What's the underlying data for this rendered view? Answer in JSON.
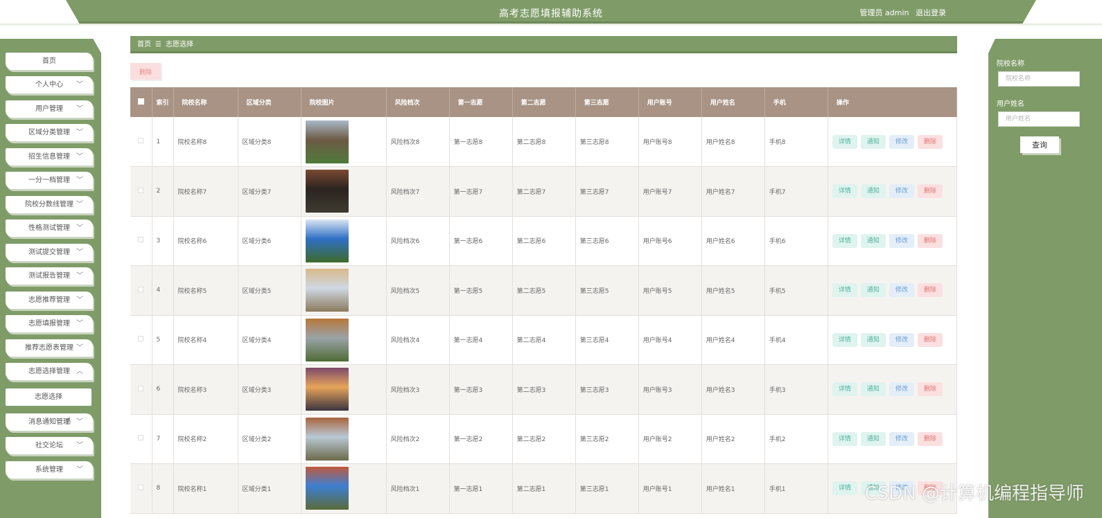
{
  "header": {
    "title": "高考志愿填报辅助系统",
    "user_label": "管理员 admin",
    "logout": "退出登录"
  },
  "sidebar": {
    "items": [
      {
        "label": "首页",
        "chevron": false
      },
      {
        "label": "个人中心",
        "chevron": true
      },
      {
        "label": "用户管理",
        "chevron": true
      },
      {
        "label": "区域分类管理",
        "chevron": true
      },
      {
        "label": "招生信息管理",
        "chevron": true
      },
      {
        "label": "一分一档管理",
        "chevron": true
      },
      {
        "label": "院校分数线管理",
        "chevron": true
      },
      {
        "label": "性格测试管理",
        "chevron": true
      },
      {
        "label": "测试提交管理",
        "chevron": true
      },
      {
        "label": "测试报告管理",
        "chevron": true
      },
      {
        "label": "志愿推荐管理",
        "chevron": true
      },
      {
        "label": "志愿填报管理",
        "chevron": true
      },
      {
        "label": "推荐志愿表管理",
        "chevron": true
      },
      {
        "label": "志愿选择管理",
        "chevron": true,
        "expanded": true
      },
      {
        "label": "志愿选择",
        "chevron": false,
        "sub": true,
        "active": true
      },
      {
        "label": "消息通知管理",
        "chevron": true
      },
      {
        "label": "社交论坛",
        "chevron": true
      },
      {
        "label": "系统管理",
        "chevron": true
      }
    ]
  },
  "breadcrumb": {
    "home": "首页",
    "sep": "☰",
    "current": "志愿选择"
  },
  "toolbar": {
    "delete_label": "删除"
  },
  "search": {
    "school_label": "院校名称",
    "school_placeholder": "院校名称",
    "user_label": "用户姓名",
    "user_placeholder": "用户姓名",
    "query_label": "查询"
  },
  "table": {
    "headers": [
      "",
      "索引",
      "院校名称",
      "区域分类",
      "院校图片",
      "风险档次",
      "第一志愿",
      "第二志愿",
      "第三志愿",
      "用户账号",
      "用户姓名",
      "手机",
      "操作"
    ],
    "ops": {
      "detail": "详情",
      "notify": "通知",
      "edit": "修改",
      "delete": "删除"
    },
    "rows": [
      {
        "idx": "1",
        "school": "院校名称8",
        "region": "区域分类8",
        "risk": "风险档次8",
        "c1": "第一志愿8",
        "c2": "第二志愿8",
        "c3": "第三志愿8",
        "account": "用户账号8",
        "name": "用户姓名8",
        "phone": "手机8",
        "img": [
          "#6d5a44",
          "#a9b8c9",
          "#4f7a3a"
        ]
      },
      {
        "idx": "2",
        "school": "院校名称7",
        "region": "区域分类7",
        "risk": "风险档次7",
        "c1": "第一志愿7",
        "c2": "第二志愿7",
        "c3": "第三志愿7",
        "account": "用户账号7",
        "name": "用户姓名7",
        "phone": "手机7",
        "img": [
          "#2b2420",
          "#7a4a32",
          "#3e3a30"
        ]
      },
      {
        "idx": "3",
        "school": "院校名称6",
        "region": "区域分类6",
        "risk": "风险档次6",
        "c1": "第一志愿6",
        "c2": "第二志愿6",
        "c3": "第三志愿6",
        "account": "用户账号6",
        "name": "用户姓名6",
        "phone": "手机6",
        "img": [
          "#2e6fc4",
          "#d9e6f2",
          "#3d6b2a"
        ]
      },
      {
        "idx": "4",
        "school": "院校名称5",
        "region": "区域分类5",
        "risk": "风险档次5",
        "c1": "第一志愿5",
        "c2": "第二志愿5",
        "c3": "第三志愿5",
        "account": "用户账号5",
        "name": "用户姓名5",
        "phone": "手机5",
        "img": [
          "#cfd8e3",
          "#d8b98a",
          "#8a7a5c"
        ]
      },
      {
        "idx": "5",
        "school": "院校名称4",
        "region": "区域分类4",
        "risk": "风险档次4",
        "c1": "第一志愿4",
        "c2": "第二志愿4",
        "c3": "第三志愿4",
        "account": "用户账号4",
        "name": "用户姓名4",
        "phone": "手机4",
        "img": [
          "#9aa3a8",
          "#b8773a",
          "#4f6b35"
        ]
      },
      {
        "idx": "6",
        "school": "院校名称3",
        "region": "区域分类3",
        "risk": "风险档次3",
        "c1": "第一志愿3",
        "c2": "第二志愿3",
        "c3": "第三志愿3",
        "account": "用户账号3",
        "name": "用户姓名3",
        "phone": "手机3",
        "img": [
          "#e7a45b",
          "#7c4a6a",
          "#3a3440"
        ]
      },
      {
        "idx": "7",
        "school": "院校名称2",
        "region": "区域分类2",
        "risk": "风险档次2",
        "c1": "第一志愿2",
        "c2": "第二志愿2",
        "c3": "第三志愿2",
        "account": "用户账号2",
        "name": "用户姓名2",
        "phone": "手机2",
        "img": [
          "#b9c8d6",
          "#a8653d",
          "#6c6a4a"
        ]
      },
      {
        "idx": "8",
        "school": "院校名称1",
        "region": "区域分类1",
        "risk": "风险档次1",
        "c1": "第一志愿1",
        "c2": "第二志愿1",
        "c3": "第三志愿1",
        "account": "用户账号1",
        "name": "用户姓名1",
        "phone": "手机1",
        "img": [
          "#3d7fd1",
          "#c05a3d",
          "#5a6b3a"
        ]
      }
    ]
  },
  "watermark": "CSDN @计算机编程指导师",
  "colors": {
    "primary": "#7f9c68",
    "table_header": "#a89385"
  }
}
